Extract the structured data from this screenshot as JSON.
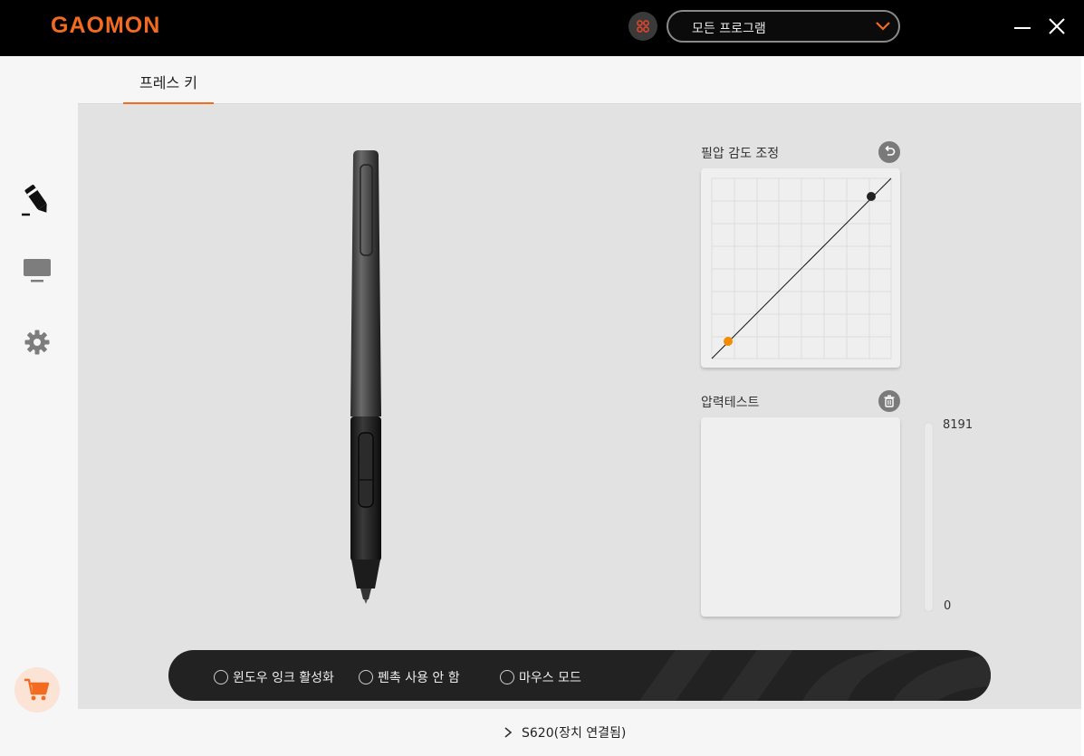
{
  "app": {
    "logo": "GAOMON"
  },
  "header": {
    "program_select": {
      "value": "모든 프로그램"
    }
  },
  "tabs": [
    {
      "label": "프레스 키",
      "active": true
    }
  ],
  "pressure_curve": {
    "title": "필압 감도 조정"
  },
  "pressure_test": {
    "title": "압력테스트",
    "max_label": "8191",
    "min_label": "0"
  },
  "options": [
    {
      "label": "윈도우 잉크 활성화",
      "checked": false
    },
    {
      "label": "펜촉 사용 안 함",
      "checked": false
    },
    {
      "label": "마우스 모드",
      "checked": false
    }
  ],
  "status": {
    "device": "S620(장치 연결됨)"
  },
  "colors": {
    "accent": "#f26b21",
    "titlebar": "#000000",
    "main_bg": "#e2e2e2",
    "option_bar": "#222222"
  },
  "icons": {
    "sidebar": [
      "pen-icon",
      "monitor-icon",
      "gear-icon"
    ],
    "header": [
      "app-grid-icon",
      "chevron-down-icon",
      "minimize-icon",
      "close-icon"
    ],
    "panels": [
      "reset-icon",
      "trash-icon"
    ],
    "other": [
      "cart-icon",
      "chevron-right-icon"
    ]
  }
}
